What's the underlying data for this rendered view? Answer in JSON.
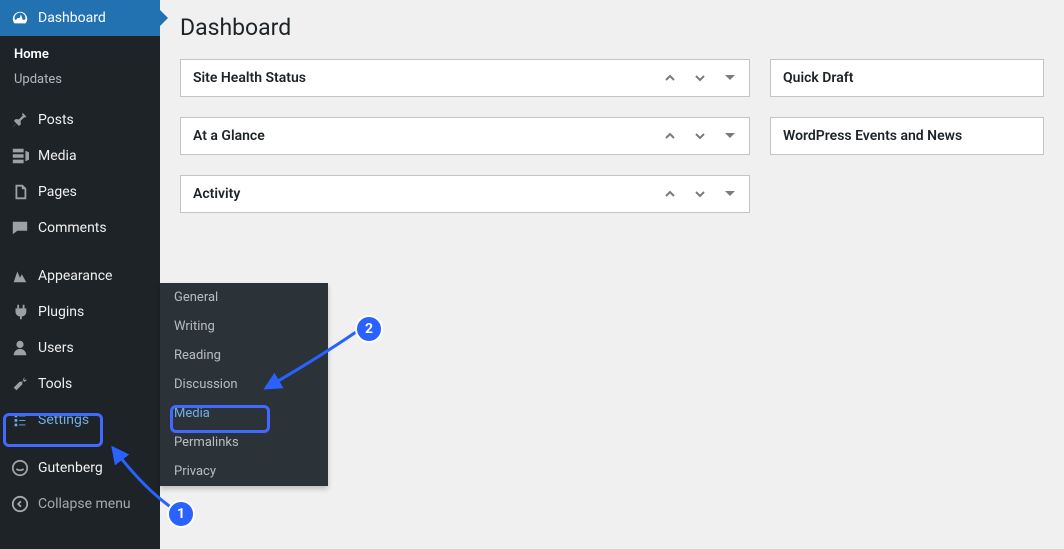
{
  "page_title": "Dashboard",
  "sidebar": {
    "dashboard": "Dashboard",
    "home": "Home",
    "updates": "Updates",
    "posts": "Posts",
    "media": "Media",
    "pages": "Pages",
    "comments": "Comments",
    "appearance": "Appearance",
    "plugins": "Plugins",
    "users": "Users",
    "tools": "Tools",
    "settings": "Settings",
    "gutenberg": "Gutenberg",
    "collapse": "Collapse menu"
  },
  "settings_submenu": {
    "general": "General",
    "writing": "Writing",
    "reading": "Reading",
    "discussion": "Discussion",
    "media": "Media",
    "permalinks": "Permalinks",
    "privacy": "Privacy"
  },
  "panels": {
    "site_health": "Site Health Status",
    "at_a_glance": "At a Glance",
    "activity": "Activity",
    "quick_draft": "Quick Draft",
    "events_news": "WordPress Events and News"
  },
  "annotations": {
    "step1": "1",
    "step2": "2"
  }
}
